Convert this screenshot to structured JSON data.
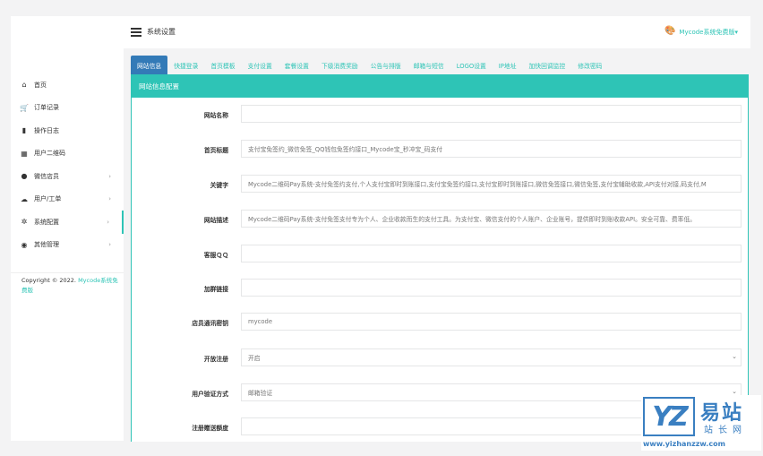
{
  "header": {
    "title": "系统设置",
    "user": "Mycode系统免费版▾"
  },
  "sidebar": {
    "items": [
      {
        "label": "首页",
        "icon": "home-icon",
        "glyph": "⌂"
      },
      {
        "label": "订单记录",
        "icon": "cart-icon",
        "glyph": "🛒"
      },
      {
        "label": "操作日志",
        "icon": "book-icon",
        "glyph": "▮"
      },
      {
        "label": "用户二维码",
        "icon": "qrcode-icon",
        "glyph": "▦"
      },
      {
        "label": "微信店员",
        "icon": "wechat-icon",
        "glyph": "●",
        "arrow": "›"
      },
      {
        "label": "用户/工单",
        "icon": "cloud-icon",
        "glyph": "☁",
        "arrow": "›"
      },
      {
        "label": "系统配置",
        "icon": "gear-icon",
        "glyph": "✲",
        "arrow": "›",
        "active": true
      },
      {
        "label": "其他管理",
        "icon": "compass-icon",
        "glyph": "◉",
        "arrow": "›"
      }
    ],
    "copyright_prefix": "Copyright © 2022. ",
    "copyright_link": "Mycode系统免费版"
  },
  "tabs": [
    "网站信息",
    "快捷登录",
    "首页模板",
    "支付设置",
    "套餐设置",
    "下级消费奖励",
    "公告与排版",
    "邮箱与短信",
    "LOGO设置",
    "IP地址",
    "加快回调监控",
    "修改密码"
  ],
  "panel": {
    "title": "网站信息配置"
  },
  "form": [
    {
      "label": "网站名称",
      "value": "",
      "placeholder": true
    },
    {
      "label": "首页标题",
      "value": "支付宝免签约_微信免签_QQ钱包免签约接口_Mycode宝_秒冲宝_码支付"
    },
    {
      "label": "关键字",
      "value": "Mycode二维码Pay系统-支付免签约支付,个人支付宝即时到账接口,支付宝免签约接口,支付宝即时到账接口,微信免签接口,微信免签,支付宝辅助收款,API支付对接,码支付,M"
    },
    {
      "label": "网站描述",
      "value": "Mycode二维码Pay系统-支付免签支付专为个人、企业收款而生的支付工具。为支付宝、微信支付的个人账户、企业账号，提供即时到账收款API。安全可靠、费率低。"
    },
    {
      "label": "客服ＱＱ",
      "value": ""
    },
    {
      "label": "加群链接",
      "value": ""
    },
    {
      "label": "店员通讯密钥",
      "value": "mycode"
    },
    {
      "label": "开放注册",
      "value": "开启",
      "select": true
    },
    {
      "label": "用户验证方式",
      "value": "邮箱验证",
      "select": true
    },
    {
      "label": "注册赠送额度",
      "value": ""
    }
  ],
  "watermark": {
    "logo": "YZ",
    "big": "易站",
    "small": "站长网",
    "url": "www.yizhanzzw.com"
  },
  "colors": {
    "accent": "#2ec4b6",
    "tab_active": "#337ab7"
  }
}
